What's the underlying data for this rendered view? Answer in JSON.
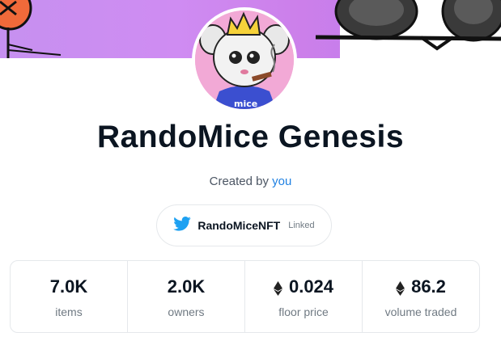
{
  "collection": {
    "title": "RandoMice Genesis",
    "created_prefix": "Created by",
    "creator_link": "you"
  },
  "twitter": {
    "icon": "twitter-bird-icon",
    "handle": "RandoMiceNFT",
    "status": "Linked"
  },
  "avatar": {
    "shirt_text": "mice"
  },
  "stats": [
    {
      "value": "7.0K",
      "label": "items",
      "icon": ""
    },
    {
      "value": "2.0K",
      "label": "owners",
      "icon": ""
    },
    {
      "value": "0.024",
      "label": "floor price",
      "icon": "eth-icon"
    },
    {
      "value": "86.2",
      "label": "volume traded",
      "icon": "eth-icon"
    }
  ],
  "colors": {
    "link": "#2081e2",
    "twitter": "#1da1f2",
    "banner": "#c690f0"
  }
}
